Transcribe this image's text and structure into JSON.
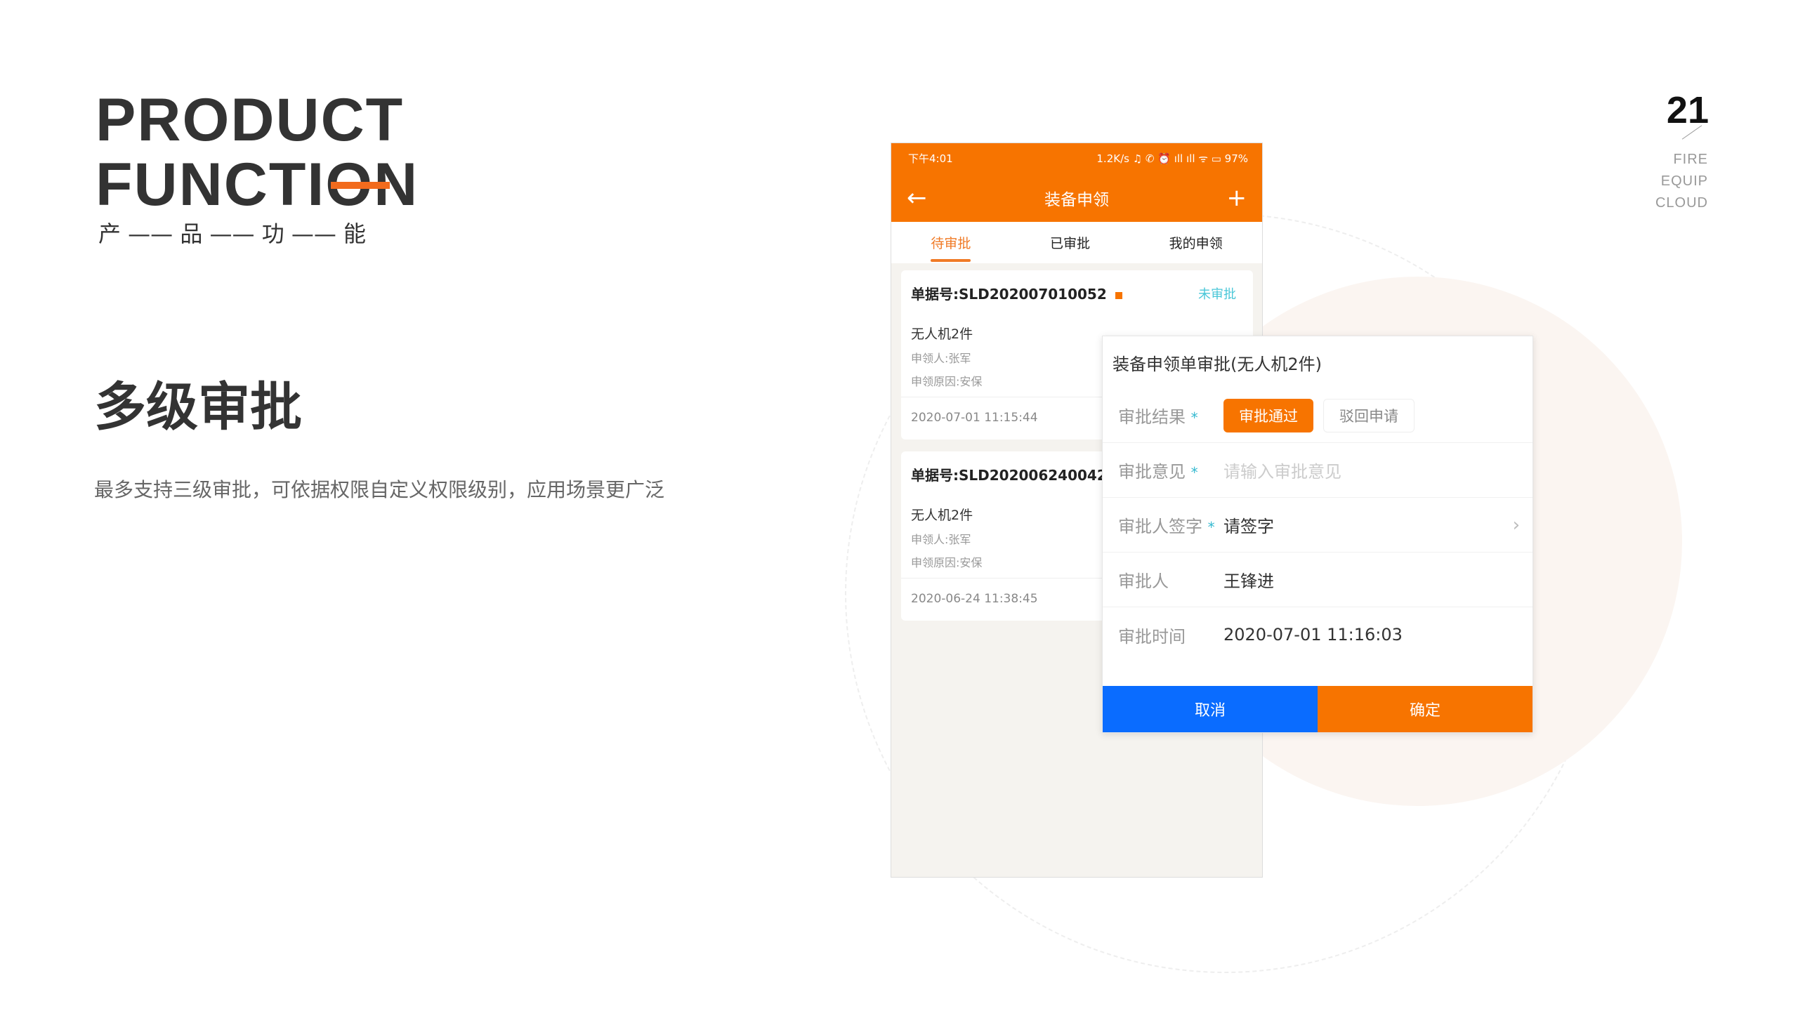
{
  "slide": {
    "title_line1": "PRODUCT",
    "title_line2": "FUNCTION",
    "subtitle": "产 —— 品 —— 功 —— 能",
    "heading": "多级审批",
    "description": "最多支持三级审批，可依据权限自定义权限级别，应用场景更广泛",
    "page_number": "21",
    "brand": [
      "FIRE",
      "EQUIP",
      "CLOUD"
    ],
    "accent_color": "#f26b1d"
  },
  "phone": {
    "status_bar": {
      "time": "下午4:01",
      "right": "1.2K/s ♫ ✆ ⏰ ıll ıll ᯤ ▭ 97%"
    },
    "navbar": {
      "title": "装备申领",
      "back_icon": "arrow-left-icon",
      "add_icon": "plus-icon"
    },
    "tabs": [
      {
        "label": "待审批",
        "active": true
      },
      {
        "label": "已审批"
      },
      {
        "label": "我的申领"
      }
    ],
    "cards": [
      {
        "no": "单据号:SLD202007010052",
        "status": "未审批",
        "item": "无人机2件",
        "applicant": "申领人:张军",
        "reason": "申领原因:安保",
        "datetime": "2020-07-01 11:15:44"
      },
      {
        "no": "单据号:SLD202006240042",
        "status": "",
        "item": "无人机2件",
        "applicant": "申领人:张军",
        "reason": "申领原因:安保",
        "datetime": "2020-06-24 11:38:45"
      }
    ],
    "theme_color": "#f77400"
  },
  "dialog": {
    "title": "装备申领单审批(无人机2件)",
    "result_label": "审批结果",
    "result_options": [
      "审批通过",
      "驳回申请"
    ],
    "result_selected": "审批通过",
    "opinion_label": "审批意见",
    "opinion_placeholder": "请输入审批意见",
    "sign_label": "审批人签字",
    "sign_value": "请签字",
    "approver_label": "审批人",
    "approver_value": "王锋进",
    "time_label": "审批时间",
    "time_value": "2020-07-01 11:16:03",
    "required_mark": "*",
    "cancel": "取消",
    "confirm": "确定",
    "cancel_color": "#0a6cff",
    "confirm_color": "#f77400"
  }
}
